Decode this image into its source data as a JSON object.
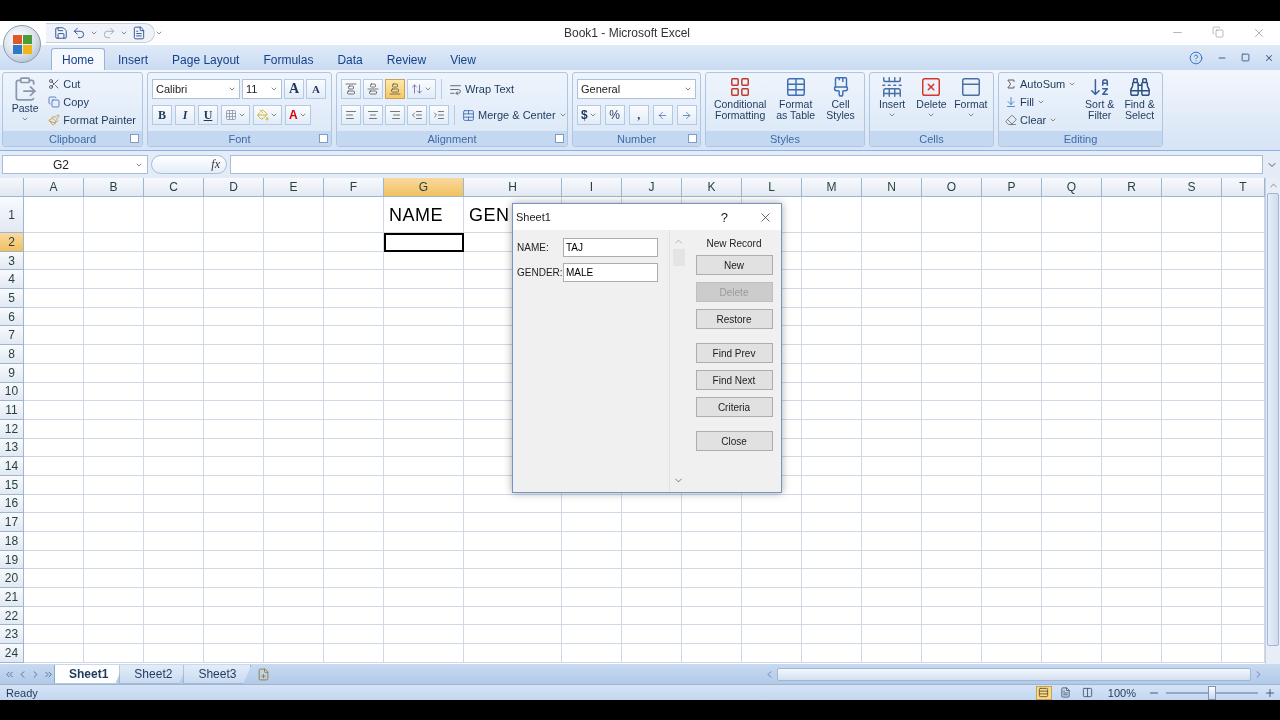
{
  "window": {
    "title": "Book1 - Microsoft Excel"
  },
  "ribbon_tabs": [
    {
      "label": "Home",
      "selected": true
    },
    {
      "label": "Insert",
      "selected": false
    },
    {
      "label": "Page Layout",
      "selected": false
    },
    {
      "label": "Formulas",
      "selected": false
    },
    {
      "label": "Data",
      "selected": false
    },
    {
      "label": "Review",
      "selected": false
    },
    {
      "label": "View",
      "selected": false
    }
  ],
  "clipboard": {
    "label": "Clipboard",
    "paste": "Paste",
    "cut": "Cut",
    "copy": "Copy",
    "format_painter": "Format Painter"
  },
  "font": {
    "label": "Font",
    "font_name": "Calibri",
    "font_size": "11",
    "grow": "A",
    "shrink": "A",
    "bold": "B",
    "italic": "I",
    "underline": "U",
    "font_color": "A"
  },
  "alignment": {
    "label": "Alignment",
    "wrap_text": "Wrap Text",
    "merge_center": "Merge & Center",
    "vertical_align": [
      {
        "selected": false
      },
      {
        "selected": false
      },
      {
        "selected": true
      }
    ]
  },
  "number": {
    "label": "Number",
    "format": "General",
    "currency": "$",
    "percent": "%",
    "comma": ","
  },
  "styles": {
    "label": "Styles",
    "buttons": [
      {
        "label": "Conditional Formatting",
        "kind": "conditional"
      },
      {
        "label": "Format as Table",
        "kind": "table"
      },
      {
        "label": "Cell Styles",
        "kind": "cellstyle"
      }
    ]
  },
  "cells": {
    "label": "Cells",
    "buttons": [
      {
        "label": "Insert",
        "kind": "insert"
      },
      {
        "label": "Delete",
        "kind": "delete"
      },
      {
        "label": "Format",
        "kind": "format"
      }
    ]
  },
  "editing": {
    "label": "Editing",
    "autosum": "AutoSum",
    "fill": "Fill",
    "clear": "Clear",
    "sort_filter": "Sort & Filter",
    "find_select": "Find & Select"
  },
  "formula_bar": {
    "name_box": "G2",
    "function_label": "fx"
  },
  "columns": [
    {
      "label": "A",
      "selected": false
    },
    {
      "label": "B",
      "selected": false
    },
    {
      "label": "C",
      "selected": false
    },
    {
      "label": "D",
      "selected": false
    },
    {
      "label": "E",
      "selected": false
    },
    {
      "label": "F",
      "selected": false
    },
    {
      "label": "G",
      "selected": true
    },
    {
      "label": "H",
      "selected": false
    },
    {
      "label": "I",
      "selected": false
    },
    {
      "label": "J",
      "selected": false
    },
    {
      "label": "K",
      "selected": false
    },
    {
      "label": "L",
      "selected": false
    },
    {
      "label": "M",
      "selected": false
    },
    {
      "label": "N",
      "selected": false
    },
    {
      "label": "O",
      "selected": false
    },
    {
      "label": "P",
      "selected": false
    },
    {
      "label": "Q",
      "selected": false
    },
    {
      "label": "R",
      "selected": false
    },
    {
      "label": "S",
      "selected": false
    },
    {
      "label": "T",
      "selected": false
    }
  ],
  "rows": [
    {
      "label": "1",
      "selected": false,
      "cells": {
        "G": "NAME",
        "H": "GEN"
      }
    },
    {
      "label": "2",
      "selected": true
    },
    {
      "label": "3",
      "selected": false
    },
    {
      "label": "4",
      "selected": false
    },
    {
      "label": "5",
      "selected": false
    },
    {
      "label": "6",
      "selected": false
    },
    {
      "label": "7",
      "selected": false
    },
    {
      "label": "8",
      "selected": false
    },
    {
      "label": "9",
      "selected": false
    },
    {
      "label": "10",
      "selected": false
    },
    {
      "label": "11",
      "selected": false
    },
    {
      "label": "12",
      "selected": false
    },
    {
      "label": "13",
      "selected": false
    },
    {
      "label": "14",
      "selected": false
    },
    {
      "label": "15",
      "selected": false
    },
    {
      "label": "16",
      "selected": false
    },
    {
      "label": "17",
      "selected": false
    },
    {
      "label": "18",
      "selected": false
    },
    {
      "label": "19",
      "selected": false
    },
    {
      "label": "20",
      "selected": false
    },
    {
      "label": "21",
      "selected": false
    },
    {
      "label": "22",
      "selected": false
    },
    {
      "label": "23",
      "selected": false
    },
    {
      "label": "24",
      "selected": false
    }
  ],
  "dialog": {
    "title": "Sheet1",
    "help": "?",
    "record_label": "New Record",
    "fields": [
      {
        "label": "NAME:",
        "value": "TAJ"
      },
      {
        "label": "GENDER:",
        "value": "MALE"
      }
    ],
    "buttons": [
      {
        "label": "New",
        "disabled": false
      },
      {
        "label": "Delete",
        "disabled": true
      },
      {
        "label": "Restore",
        "disabled": false
      },
      {
        "label": "Find Prev",
        "disabled": false
      },
      {
        "label": "Find Next",
        "disabled": false
      },
      {
        "label": "Criteria",
        "disabled": false
      },
      {
        "label": "Close",
        "disabled": false
      }
    ]
  },
  "sheet_tabs": [
    {
      "label": "Sheet1",
      "selected": true
    },
    {
      "label": "Sheet2",
      "selected": false
    },
    {
      "label": "Sheet3",
      "selected": false
    }
  ],
  "status_bar": {
    "text": "Ready",
    "zoom": "100%",
    "zoom_slider": {
      "level": 0.5
    }
  }
}
